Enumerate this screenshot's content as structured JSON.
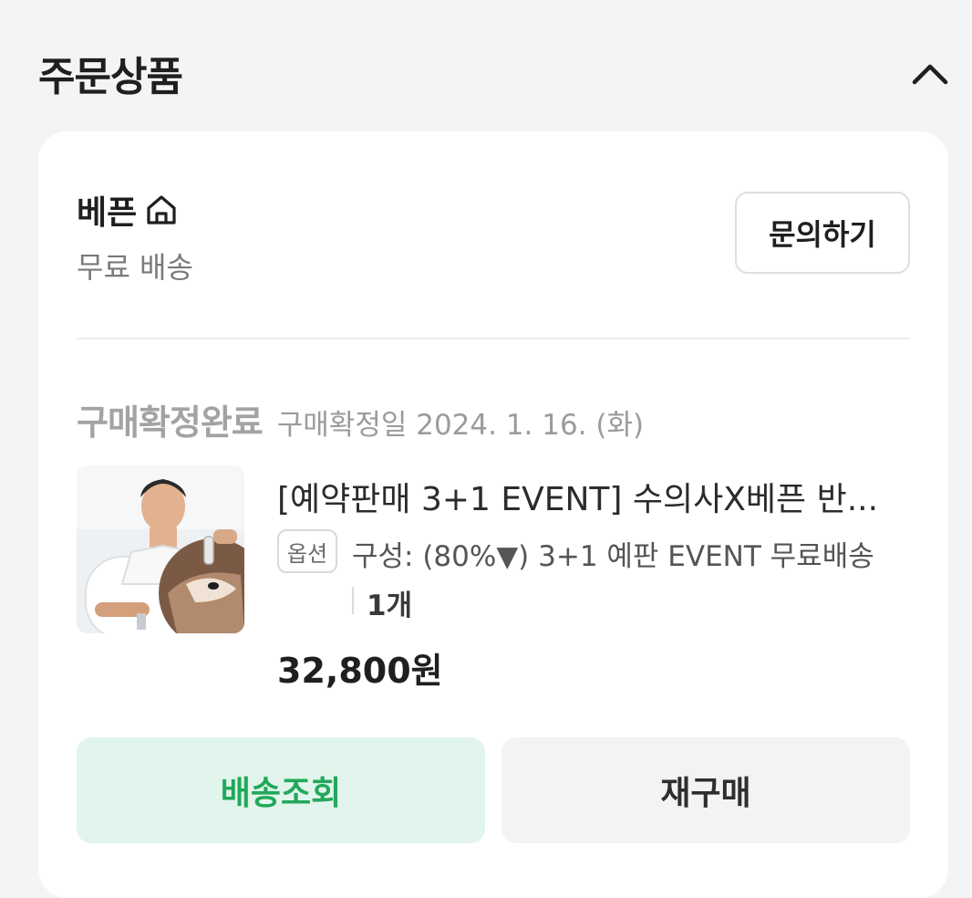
{
  "section": {
    "title": "주문상품"
  },
  "seller": {
    "name": "베픈",
    "shipping": "무료 배송",
    "inquiry_label": "문의하기"
  },
  "order": {
    "status": "구매확정완료",
    "confirm_date": "구매확정일 2024. 1. 16. (화)"
  },
  "product": {
    "title": "[예약판매 3+1 EVENT] 수의사X베픈 반...",
    "option_badge": "옵션",
    "option_text": "구성: (80%▼) 3+1 예판 EVENT 무료배송",
    "quantity": "1개",
    "price": "32,800원"
  },
  "actions": {
    "tracking_label": "배송조회",
    "reorder_label": "재구매"
  },
  "colors": {
    "accent_green": "#22a85a",
    "tracking_bg": "#e2f5ec",
    "page_bg": "#f3f4f6"
  }
}
